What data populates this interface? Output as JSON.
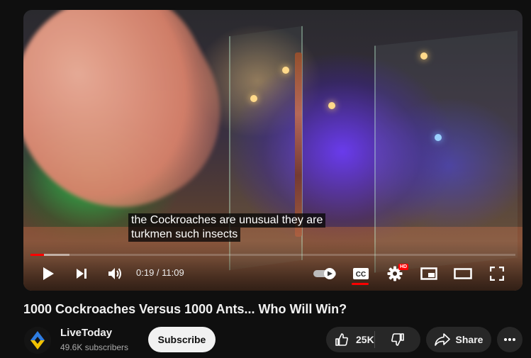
{
  "video": {
    "captions": [
      "the Cockroaches are unusual they are",
      "turkmen such insects"
    ],
    "time": "0:19 / 11:09",
    "progress_played_fraction": 0.028,
    "hd_badge": "HD"
  },
  "meta": {
    "title": "1000 Cockroaches Versus 1000 Ants... Who Will Win?",
    "channel_name": "LiveToday",
    "subscribers": "49.6K subscribers",
    "subscribe_label": "Subscribe",
    "like_count": "25K",
    "share_label": "Share"
  },
  "icons": [
    "play-icon",
    "next-icon",
    "volume-icon",
    "autoplay-toggle-icon",
    "captions-icon",
    "settings-icon",
    "miniplayer-icon",
    "theater-icon",
    "fullscreen-icon",
    "like-icon",
    "dislike-icon",
    "share-icon",
    "more-icon"
  ],
  "colors": {
    "accent": "#ff0000",
    "background": "#0f0f0f",
    "button_bg": "#272727"
  }
}
